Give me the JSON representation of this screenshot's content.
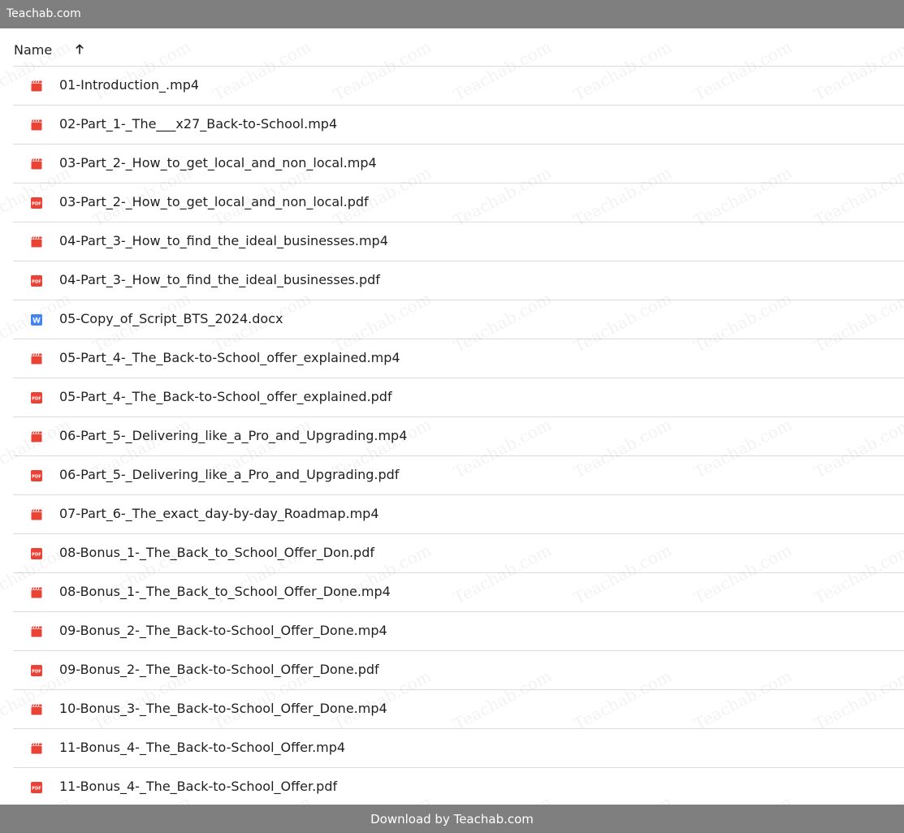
{
  "window": {
    "title": "Teachab.com"
  },
  "header": {
    "name_label": "Name",
    "sort_icon": "arrow-up-icon"
  },
  "colors": {
    "bar": "#7f7f7f",
    "video_icon": "#ea4335",
    "pdf_icon": "#ea4335",
    "doc_icon": "#4285f4",
    "divider": "#dadce0"
  },
  "files": [
    {
      "name": "01-Introduction_.mp4",
      "type": "video"
    },
    {
      "name": "02-Part_1-_The___x27_Back-to-School.mp4",
      "type": "video"
    },
    {
      "name": "03-Part_2-_How_to_get_local_and_non_local.mp4",
      "type": "video"
    },
    {
      "name": "03-Part_2-_How_to_get_local_and_non_local.pdf",
      "type": "pdf"
    },
    {
      "name": "04-Part_3-_How_to_find_the_ideal_businesses.mp4",
      "type": "video"
    },
    {
      "name": "04-Part_3-_How_to_find_the_ideal_businesses.pdf",
      "type": "pdf"
    },
    {
      "name": "05-Copy_of_Script_BTS_2024.docx",
      "type": "doc"
    },
    {
      "name": "05-Part_4-_The_Back-to-School_offer_explained.mp4",
      "type": "video"
    },
    {
      "name": "05-Part_4-_The_Back-to-School_offer_explained.pdf",
      "type": "pdf"
    },
    {
      "name": "06-Part_5-_Delivering_like_a_Pro_and_Upgrading.mp4",
      "type": "video"
    },
    {
      "name": "06-Part_5-_Delivering_like_a_Pro_and_Upgrading.pdf",
      "type": "pdf"
    },
    {
      "name": "07-Part_6-_The_exact_day-by-day_Roadmap.mp4",
      "type": "video"
    },
    {
      "name": "08-Bonus_1-_The_Back_to_School_Offer_Don.pdf",
      "type": "pdf"
    },
    {
      "name": "08-Bonus_1-_The_Back_to_School_Offer_Done.mp4",
      "type": "video"
    },
    {
      "name": "09-Bonus_2-_The_Back-to-School_Offer_Done.mp4",
      "type": "video"
    },
    {
      "name": "09-Bonus_2-_The_Back-to-School_Offer_Done.pdf",
      "type": "pdf"
    },
    {
      "name": "10-Bonus_3-_The_Back-to-School_Offer_Done.mp4",
      "type": "video"
    },
    {
      "name": "11-Bonus_4-_The_Back-to-School_Offer.mp4",
      "type": "video"
    },
    {
      "name": "11-Bonus_4-_The_Back-to-School_Offer.pdf",
      "type": "pdf"
    }
  ],
  "footer": {
    "text": "Download by Teachab.com"
  },
  "watermark": {
    "text": "Teachab.com"
  }
}
